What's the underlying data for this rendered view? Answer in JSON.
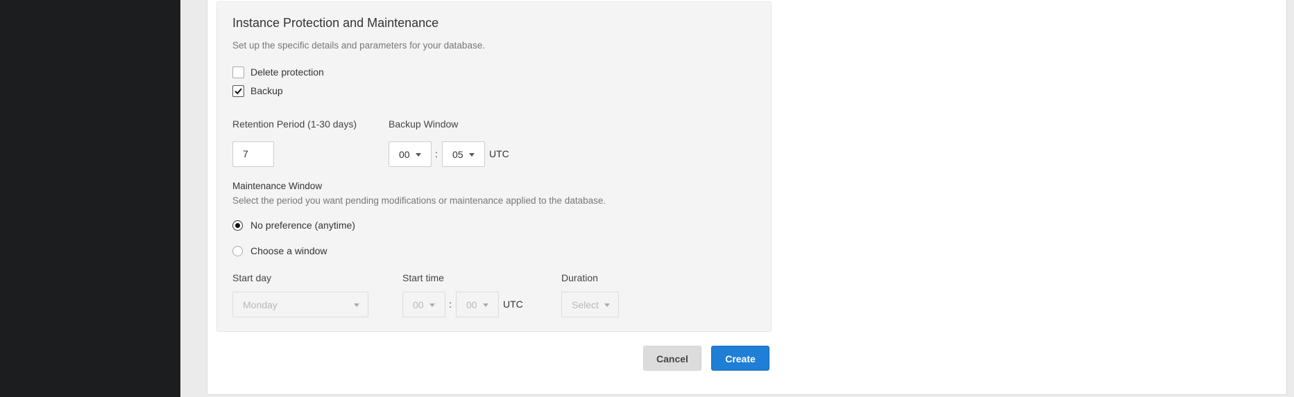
{
  "section": {
    "title": "Instance Protection and Maintenance",
    "subtitle": "Set up the specific details and parameters for your database."
  },
  "protection": {
    "delete_protection": {
      "label": "Delete protection",
      "checked": false
    },
    "backup": {
      "label": "Backup",
      "checked": true
    }
  },
  "retention": {
    "label": "Retention Period (1-30 days)",
    "value": "7"
  },
  "backup_window": {
    "label": "Backup Window",
    "hour": "00",
    "minute": "05",
    "separator": ":",
    "timezone": "UTC"
  },
  "maintenance": {
    "title": "Maintenance Window",
    "description": "Select the period you want pending modifications or maintenance applied to the database.",
    "options": [
      {
        "label": "No preference (anytime)",
        "selected": true
      },
      {
        "label": "Choose a window",
        "selected": false
      }
    ],
    "start_day": {
      "label": "Start day",
      "value": "Monday"
    },
    "start_time": {
      "label": "Start time",
      "hour": "00",
      "minute": "00",
      "separator": ":",
      "timezone": "UTC"
    },
    "duration": {
      "label": "Duration",
      "value": "Select"
    }
  },
  "actions": {
    "cancel": "Cancel",
    "create": "Create"
  },
  "colors": {
    "sidebar": "#1c1d1f",
    "primary": "#1f7fd6"
  }
}
